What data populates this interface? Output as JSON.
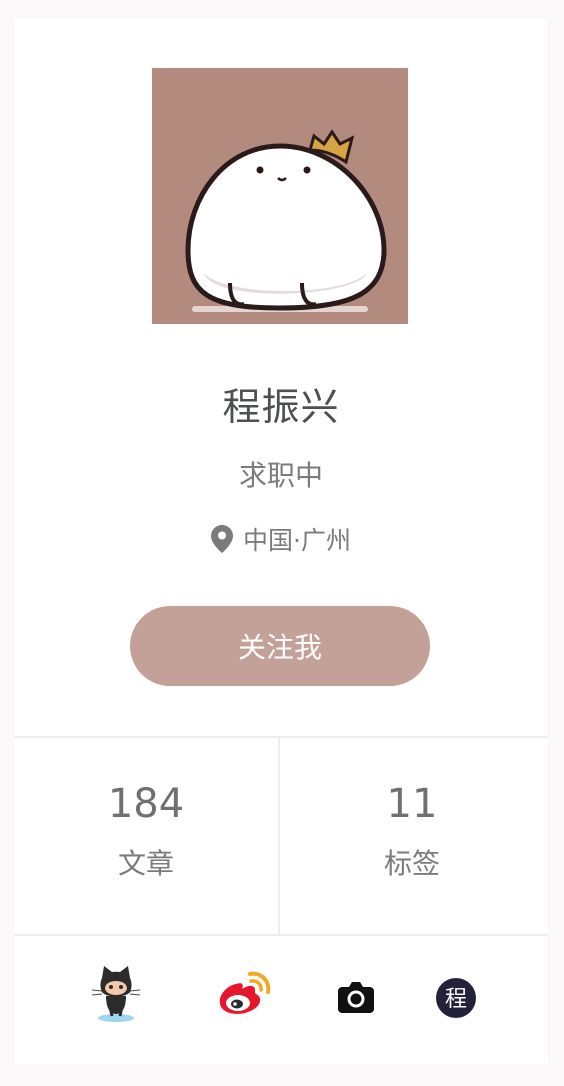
{
  "profile": {
    "name": "程振兴",
    "status": "求职中",
    "location": "中国·广州",
    "follow_label": "关注我"
  },
  "stats": [
    {
      "value": "184",
      "label": "文章"
    },
    {
      "value": "11",
      "label": "标签"
    }
  ],
  "social_links": [
    {
      "icon": "github-octocat-icon"
    },
    {
      "icon": "weibo-icon"
    },
    {
      "icon": "camera-icon"
    },
    {
      "icon": "cheng-badge-icon",
      "glyph": "程"
    }
  ],
  "colors": {
    "accent": "#c3a098",
    "avatar_bg": "#b38b7e",
    "text_dark": "#4d4f52",
    "text_muted": "#7b7b7b"
  }
}
